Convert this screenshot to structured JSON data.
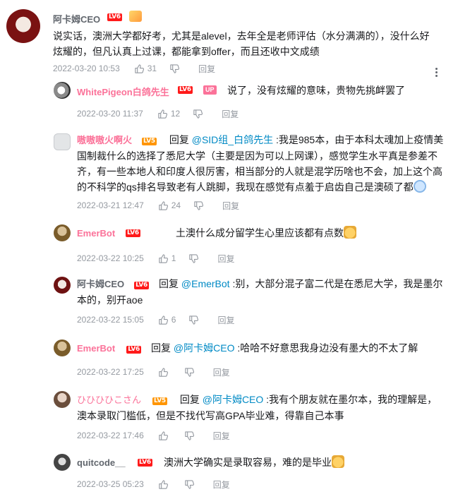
{
  "main": {
    "username": "阿卡姆CEO",
    "level": "LV6",
    "text": "说实话，澳洲大学都好考，尤其是alevel，去年全是老师评估（水分满满的），没什么好炫耀的，但凡认真上过课，都能拿到offer，而且还收中文成绩",
    "time": "2022-03-20 10:53",
    "likes": "31",
    "reply_label": "回复"
  },
  "replies": [
    {
      "username": "WhitePigeon白鸽先生",
      "level": "LV6",
      "up_badge": "UP",
      "text": "说了，没有炫耀的意味，贵物先挑衅罢了",
      "time": "2022-03-20 11:37",
      "likes": "12",
      "reply_label": "回复"
    },
    {
      "username": "嗷嗷嗷火啊火",
      "level": "LV5",
      "reply_word": "回复",
      "mention": "@SID组_白鸽先生",
      "text": " :我是985本，由于本科太魂加上疫情美国制裁什么的选择了悉尼大学（主要是因为可以上网课），感觉学生水平真是参差不齐，有一些本地人和印度人很厉害，相当部分的人就是混学历啥也不会，加上这个高的不科学的qs排名导致老有人跳脚，我现在感觉有点羞于启齿自己是澳硕了都",
      "time": "2022-03-21 12:47",
      "likes": "24",
      "reply_label": "回复"
    },
    {
      "username": "EmerBot",
      "level": "LV6",
      "text": "土澳什么成分留学生心里应该都有点数",
      "time": "2022-03-22 10:25",
      "likes": "1",
      "reply_label": "回复"
    },
    {
      "username": "阿卡姆CEO",
      "level": "LV6",
      "reply_word": "回复",
      "mention": "@EmerBot",
      "text": " :别，大部分混子富二代是在悉尼大学，我是墨尔本的，别开aoe",
      "time": "2022-03-22 15:05",
      "likes": "6",
      "reply_label": "回复"
    },
    {
      "username": "EmerBot",
      "level": "LV6",
      "reply_word": "回复",
      "mention": "@阿卡姆CEO",
      "text": " :哈哈不好意思我身边没有墨大的不太了解",
      "time": "2022-03-22 17:25",
      "likes": "",
      "reply_label": "回复"
    },
    {
      "username": "ひひひひこさん",
      "level": "LV5",
      "reply_word": "回复",
      "mention": "@阿卡姆CEO",
      "text": " :我有个朋友就在墨尔本，我的理解是，澳本录取门槛低，但是不找代写高GPA毕业难，得靠自己本事",
      "time": "2022-03-22 17:46",
      "likes": "",
      "reply_label": "回复"
    },
    {
      "username": "quitcode__",
      "level": "LV6",
      "text": "澳洲大学确实是录取容易，难的是毕业",
      "time": "2022-03-25 05:23",
      "likes": "",
      "reply_label": "回复"
    }
  ]
}
